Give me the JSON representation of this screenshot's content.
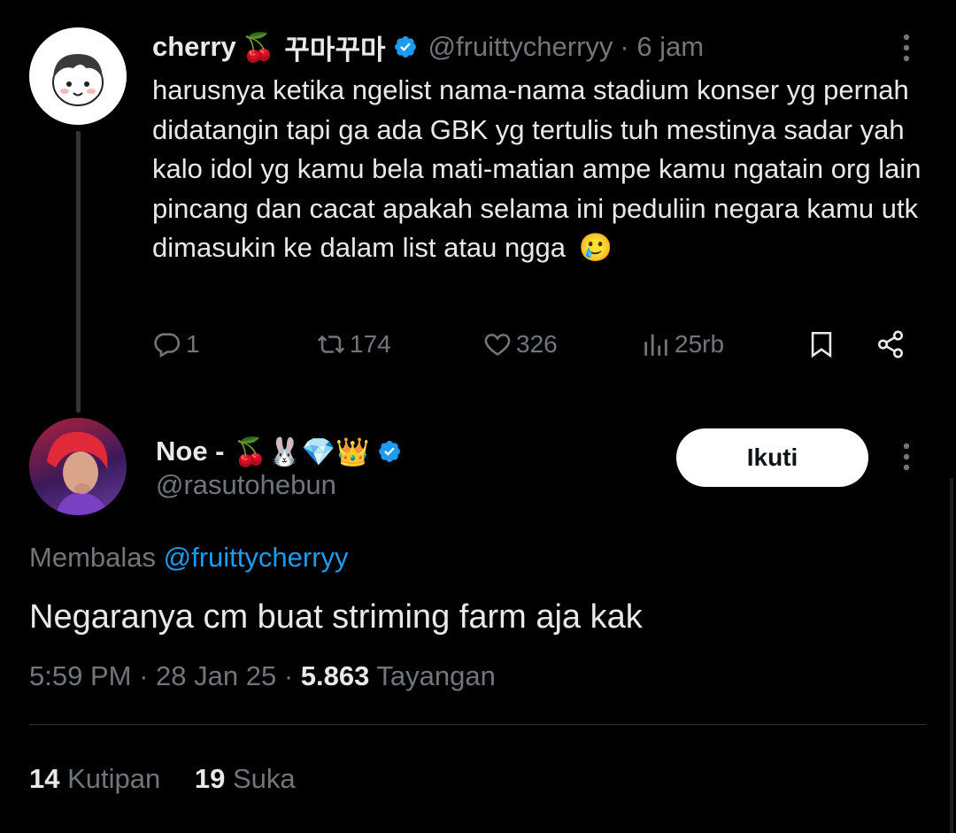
{
  "original_tweet": {
    "display_name": "cherry",
    "name_emojis": "🍒",
    "name_korean": "꾸마꾸마",
    "handle": "@fruittycherryy",
    "time": "· 6 jam",
    "text": "harusnya ketika ngelist nama-nama stadium konser yg pernah didatangin tapi ga ada GBK yg tertulis tuh mestinya sadar yah kalo idol yg kamu bela mati-matian ampe kamu ngatain org lain pincang dan cacat apakah selama ini peduliin negara kamu utk dimasukin ke dalam list atau ngga",
    "text_emoji": "🥲",
    "replies": "1",
    "retweets": "174",
    "likes": "326",
    "views": "25rb"
  },
  "reply_tweet": {
    "display_name": "Noe -",
    "name_emojis": "🍒🐰💎👑",
    "handle": "@rasutohebun",
    "follow_label": "Ikuti",
    "replying_to_label": "Membalas",
    "replying_to_handle": "@fruittycherryy",
    "text": "Negaranya cm buat striming farm aja kak",
    "time": "5:59 PM",
    "date": "28 Jan 25",
    "views_count": "5.863",
    "views_label": "Tayangan",
    "quotes_count": "14",
    "quotes_label": "Kutipan",
    "likes_count": "19",
    "likes_label": "Suka"
  },
  "colors": {
    "background": "#000000",
    "text": "#e7e9ea",
    "muted": "#71767b",
    "link": "#1d9bf0",
    "verified": "#1d9bf0"
  }
}
